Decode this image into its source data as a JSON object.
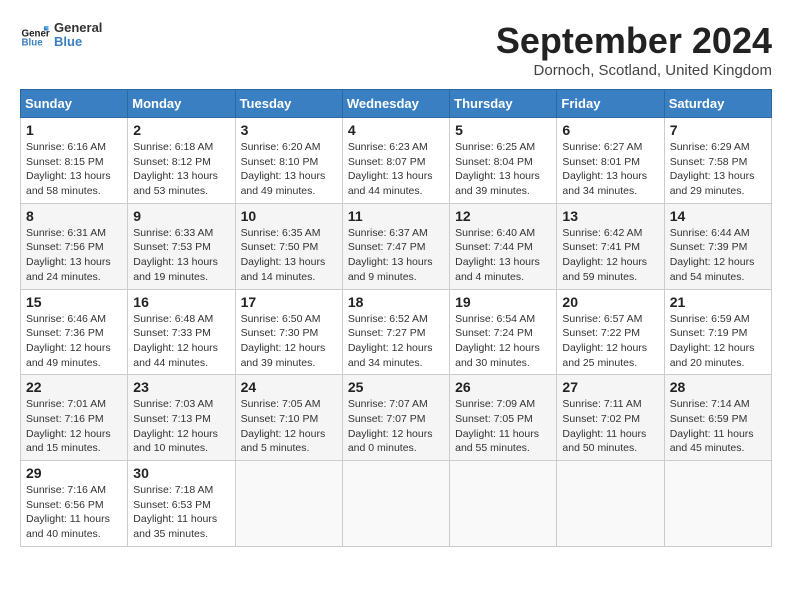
{
  "header": {
    "logo_line1": "General",
    "logo_line2": "Blue",
    "month_title": "September 2024",
    "location": "Dornoch, Scotland, United Kingdom"
  },
  "days_of_week": [
    "Sunday",
    "Monday",
    "Tuesday",
    "Wednesday",
    "Thursday",
    "Friday",
    "Saturday"
  ],
  "weeks": [
    [
      {
        "day": "1",
        "info": "Sunrise: 6:16 AM\nSunset: 8:15 PM\nDaylight: 13 hours\nand 58 minutes."
      },
      {
        "day": "2",
        "info": "Sunrise: 6:18 AM\nSunset: 8:12 PM\nDaylight: 13 hours\nand 53 minutes."
      },
      {
        "day": "3",
        "info": "Sunrise: 6:20 AM\nSunset: 8:10 PM\nDaylight: 13 hours\nand 49 minutes."
      },
      {
        "day": "4",
        "info": "Sunrise: 6:23 AM\nSunset: 8:07 PM\nDaylight: 13 hours\nand 44 minutes."
      },
      {
        "day": "5",
        "info": "Sunrise: 6:25 AM\nSunset: 8:04 PM\nDaylight: 13 hours\nand 39 minutes."
      },
      {
        "day": "6",
        "info": "Sunrise: 6:27 AM\nSunset: 8:01 PM\nDaylight: 13 hours\nand 34 minutes."
      },
      {
        "day": "7",
        "info": "Sunrise: 6:29 AM\nSunset: 7:58 PM\nDaylight: 13 hours\nand 29 minutes."
      }
    ],
    [
      {
        "day": "8",
        "info": "Sunrise: 6:31 AM\nSunset: 7:56 PM\nDaylight: 13 hours\nand 24 minutes."
      },
      {
        "day": "9",
        "info": "Sunrise: 6:33 AM\nSunset: 7:53 PM\nDaylight: 13 hours\nand 19 minutes."
      },
      {
        "day": "10",
        "info": "Sunrise: 6:35 AM\nSunset: 7:50 PM\nDaylight: 13 hours\nand 14 minutes."
      },
      {
        "day": "11",
        "info": "Sunrise: 6:37 AM\nSunset: 7:47 PM\nDaylight: 13 hours\nand 9 minutes."
      },
      {
        "day": "12",
        "info": "Sunrise: 6:40 AM\nSunset: 7:44 PM\nDaylight: 13 hours\nand 4 minutes."
      },
      {
        "day": "13",
        "info": "Sunrise: 6:42 AM\nSunset: 7:41 PM\nDaylight: 12 hours\nand 59 minutes."
      },
      {
        "day": "14",
        "info": "Sunrise: 6:44 AM\nSunset: 7:39 PM\nDaylight: 12 hours\nand 54 minutes."
      }
    ],
    [
      {
        "day": "15",
        "info": "Sunrise: 6:46 AM\nSunset: 7:36 PM\nDaylight: 12 hours\nand 49 minutes."
      },
      {
        "day": "16",
        "info": "Sunrise: 6:48 AM\nSunset: 7:33 PM\nDaylight: 12 hours\nand 44 minutes."
      },
      {
        "day": "17",
        "info": "Sunrise: 6:50 AM\nSunset: 7:30 PM\nDaylight: 12 hours\nand 39 minutes."
      },
      {
        "day": "18",
        "info": "Sunrise: 6:52 AM\nSunset: 7:27 PM\nDaylight: 12 hours\nand 34 minutes."
      },
      {
        "day": "19",
        "info": "Sunrise: 6:54 AM\nSunset: 7:24 PM\nDaylight: 12 hours\nand 30 minutes."
      },
      {
        "day": "20",
        "info": "Sunrise: 6:57 AM\nSunset: 7:22 PM\nDaylight: 12 hours\nand 25 minutes."
      },
      {
        "day": "21",
        "info": "Sunrise: 6:59 AM\nSunset: 7:19 PM\nDaylight: 12 hours\nand 20 minutes."
      }
    ],
    [
      {
        "day": "22",
        "info": "Sunrise: 7:01 AM\nSunset: 7:16 PM\nDaylight: 12 hours\nand 15 minutes."
      },
      {
        "day": "23",
        "info": "Sunrise: 7:03 AM\nSunset: 7:13 PM\nDaylight: 12 hours\nand 10 minutes."
      },
      {
        "day": "24",
        "info": "Sunrise: 7:05 AM\nSunset: 7:10 PM\nDaylight: 12 hours\nand 5 minutes."
      },
      {
        "day": "25",
        "info": "Sunrise: 7:07 AM\nSunset: 7:07 PM\nDaylight: 12 hours\nand 0 minutes."
      },
      {
        "day": "26",
        "info": "Sunrise: 7:09 AM\nSunset: 7:05 PM\nDaylight: 11 hours\nand 55 minutes."
      },
      {
        "day": "27",
        "info": "Sunrise: 7:11 AM\nSunset: 7:02 PM\nDaylight: 11 hours\nand 50 minutes."
      },
      {
        "day": "28",
        "info": "Sunrise: 7:14 AM\nSunset: 6:59 PM\nDaylight: 11 hours\nand 45 minutes."
      }
    ],
    [
      {
        "day": "29",
        "info": "Sunrise: 7:16 AM\nSunset: 6:56 PM\nDaylight: 11 hours\nand 40 minutes."
      },
      {
        "day": "30",
        "info": "Sunrise: 7:18 AM\nSunset: 6:53 PM\nDaylight: 11 hours\nand 35 minutes."
      },
      {
        "day": "",
        "info": ""
      },
      {
        "day": "",
        "info": ""
      },
      {
        "day": "",
        "info": ""
      },
      {
        "day": "",
        "info": ""
      },
      {
        "day": "",
        "info": ""
      }
    ]
  ]
}
